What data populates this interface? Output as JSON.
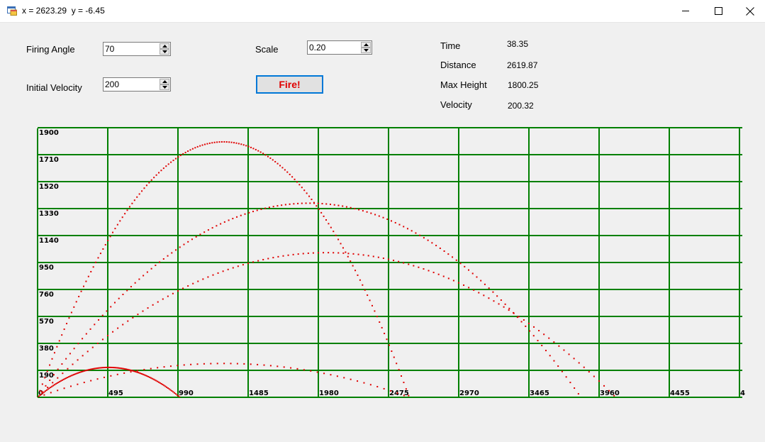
{
  "window": {
    "title": "x = 2623.29  y = -6.45",
    "icon": "app-window-icon",
    "controls": [
      "minimize-icon",
      "maximize-icon",
      "close-icon"
    ]
  },
  "inputs": {
    "firing_angle_label": "Firing Angle",
    "firing_angle_value": "70",
    "initial_velocity_label": "Initial Velocity",
    "initial_velocity_value": "200",
    "scale_label": "Scale",
    "scale_value": "0.20"
  },
  "fire_button": {
    "label": "Fire!",
    "text_color": "#e00000",
    "border_color": "#0078d7"
  },
  "stats": {
    "time_label": "Time",
    "time_value": "38.35",
    "distance_label": "Distance",
    "distance_value": "2619.87",
    "max_height_label": "Max Height",
    "max_height_value": "1800.25",
    "velocity_label": "Velocity",
    "velocity_value": "200.32"
  },
  "chart_data": {
    "type": "scatter",
    "grid": true,
    "grid_color": "#008000",
    "series_color": "#e00000",
    "xlim": [
      0,
      5000
    ],
    "ylim": [
      0,
      1900
    ],
    "x_ticks": [
      "0",
      "495",
      "990",
      "1485",
      "1980",
      "2475",
      "2970",
      "3465",
      "3960",
      "4455",
      "4"
    ],
    "y_ticks": [
      "1900",
      "1710",
      "1520",
      "1330",
      "1140",
      "950",
      "760",
      "570",
      "380",
      "190"
    ],
    "velocity": 200,
    "g": 9.81,
    "series": [
      {
        "angle": 20
      },
      {
        "angle": 45
      },
      {
        "angle": 55
      },
      {
        "angle": 70
      },
      {
        "angle": 40,
        "velocity": 100
      }
    ]
  }
}
